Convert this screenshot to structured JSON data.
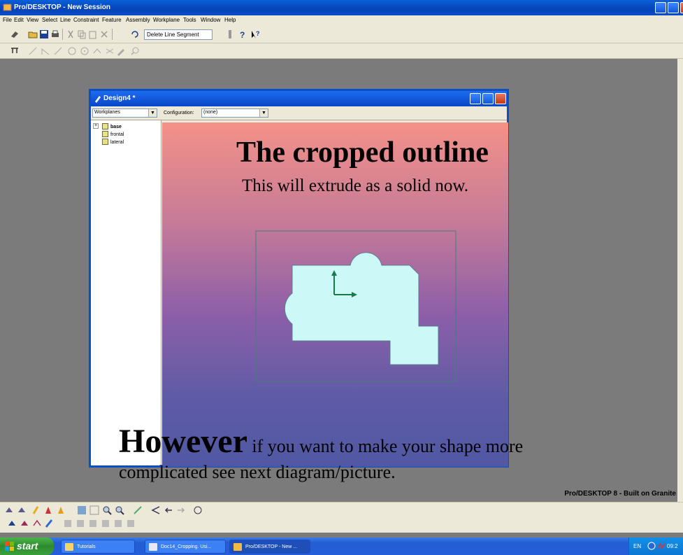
{
  "app": {
    "title": "Pro/DESKTOP - New Session"
  },
  "menu": [
    "File",
    "Edit",
    "View",
    "Select",
    "Line",
    "Constraint",
    "Feature",
    "Assembly",
    "Workplane",
    "Tools",
    "Window",
    "Help"
  ],
  "toolbar": {
    "command_field": "Delete Line Segment"
  },
  "design_window": {
    "title": "Design4 *",
    "browser_select": "Workplanes",
    "configuration_label": "Configuration:",
    "configuration_value": "(none)",
    "tree": [
      "base",
      "frontal",
      "lateral"
    ]
  },
  "overlay": {
    "heading": "The cropped outline",
    "subline": "This will extrude as a solid now.",
    "however_big": "However",
    "however_rest": "if you want to make your shape more",
    "continuation": "complicated see next diagram/picture."
  },
  "brand": "Pro/DESKTOP 8 - Built on Granite",
  "taskbar": {
    "start": "start",
    "tasks": [
      "Tutorials",
      "Doc14_Cropping. Usi...",
      "Pro/DESKTOP - New ..."
    ],
    "lang": "EN",
    "clock": "09:2"
  },
  "colors": {
    "accent": "#0a4ec8",
    "sketch_fill": "#ccf8f8",
    "workspace": "#7b7b7b"
  }
}
